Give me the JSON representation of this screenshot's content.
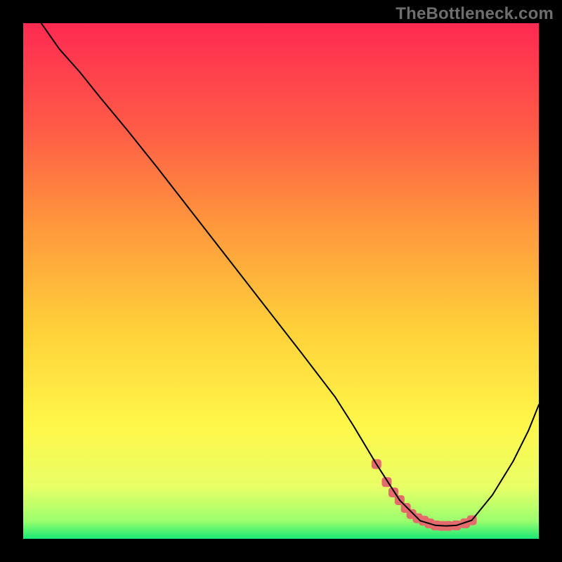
{
  "watermark": "TheBottleneck.com",
  "chart_data": {
    "type": "line",
    "title": "",
    "xlabel": "",
    "ylabel": "",
    "xlim": [
      0,
      100
    ],
    "ylim": [
      0,
      100
    ],
    "grid": false,
    "legend": false,
    "background_gradient": {
      "stops": [
        {
          "offset": 0.0,
          "color": "#ff2a52"
        },
        {
          "offset": 0.2,
          "color": "#ff5a47"
        },
        {
          "offset": 0.4,
          "color": "#ff9a3c"
        },
        {
          "offset": 0.6,
          "color": "#ffd23a"
        },
        {
          "offset": 0.78,
          "color": "#fff74a"
        },
        {
          "offset": 0.9,
          "color": "#e8ff66"
        },
        {
          "offset": 0.965,
          "color": "#9cff6e"
        },
        {
          "offset": 1.0,
          "color": "#18e874"
        }
      ]
    },
    "series": [
      {
        "name": "bottleneck-curve",
        "color": "#000000",
        "stroke_width": 2,
        "x": [
          3.5,
          7,
          11,
          15,
          20,
          26,
          33,
          40,
          47,
          54,
          60.5,
          64,
          67,
          68.5,
          73,
          77,
          80,
          82,
          84,
          87,
          91,
          95,
          98,
          100
        ],
        "y": [
          100,
          95,
          90.5,
          85.5,
          79.5,
          72,
          63,
          54,
          45,
          36,
          27.5,
          22,
          17,
          14.5,
          7.5,
          3.5,
          2.6,
          2.5,
          2.6,
          3.6,
          8.5,
          15,
          21,
          26
        ]
      }
    ],
    "markers": {
      "name": "optimal-range",
      "color": "#e46b6b",
      "shape": "rounded-square",
      "size": 14,
      "x": [
        68.5,
        70.5,
        71.8,
        73.0,
        74.2,
        75.3,
        76.5,
        77.7,
        78.8,
        80.0,
        81.2,
        82.4,
        84.0,
        85.7,
        87.0
      ],
      "y": [
        14.5,
        11.0,
        9.0,
        7.5,
        6.0,
        4.8,
        4.0,
        3.5,
        3.0,
        2.6,
        2.5,
        2.5,
        2.6,
        3.0,
        3.6
      ]
    }
  }
}
